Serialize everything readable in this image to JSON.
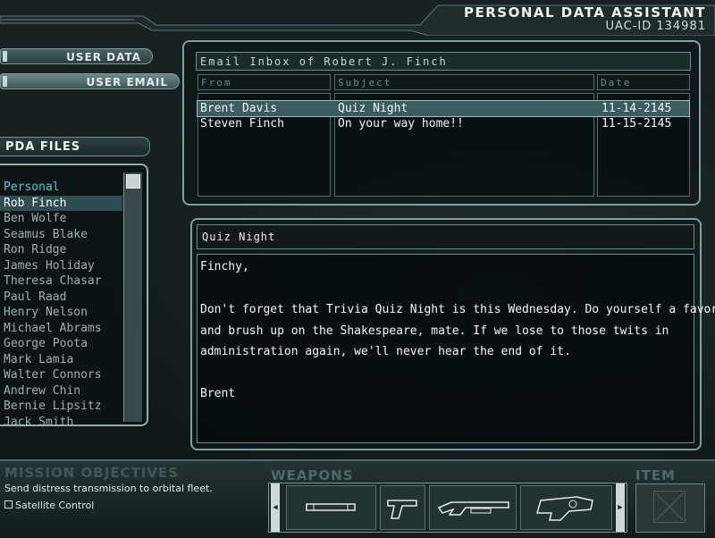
{
  "header": {
    "title": "PERSONAL DATA ASSISTANT",
    "uac_id": "UAC-ID 134981"
  },
  "nav": {
    "user_data": "USER DATA",
    "user_email": "USER EMAIL"
  },
  "files": {
    "title": "PDA FILES",
    "items": [
      "Personal",
      "Rob Finch",
      "Ben Wolfe",
      "Seamus Blake",
      "Ron Ridge",
      "James Holiday",
      "Theresa Chasar",
      "Paul Raad",
      "Henry Nelson",
      "Michael Abrams",
      "George Poota",
      "Mark Lamia",
      "Walter Connors",
      "Andrew Chin",
      "Bernie Lipsitz",
      "Jack Smith"
    ]
  },
  "inbox": {
    "title": "Email Inbox of Robert J. Finch",
    "columns": {
      "from": "From",
      "subject": "Subject",
      "date": "Date"
    },
    "rows": [
      {
        "from": "Brent Davis",
        "subject": "Quiz Night",
        "date": "11-14-2145"
      },
      {
        "from": "Steven Finch",
        "subject": "On your way home!!",
        "date": "11-15-2145"
      }
    ]
  },
  "message": {
    "subject": "Quiz Night",
    "lines": [
      "Finchy,",
      "Don't forget that Trivia Quiz Night is this Wednesday.  Do yourself a favor",
      "and brush up on the Shakespeare, mate.  If we lose to those twits in",
      "administration again, we'll never hear the end of it.",
      "Brent"
    ]
  },
  "objectives": {
    "title": "MISSION OBJECTIVES",
    "text": "Send distress transmission to orbital fleet.",
    "items": [
      "Satellite Control"
    ]
  },
  "weapons": {
    "title": "WEAPONS",
    "slots": [
      "flashlight-icon",
      "pistol-icon",
      "shotgun-icon",
      "machinegun-icon"
    ]
  },
  "item": {
    "title": "ITEM"
  },
  "colors": {
    "accent": "#3fd4d8",
    "frame": "#7fa0a0",
    "selection": "#3b5d5f"
  }
}
